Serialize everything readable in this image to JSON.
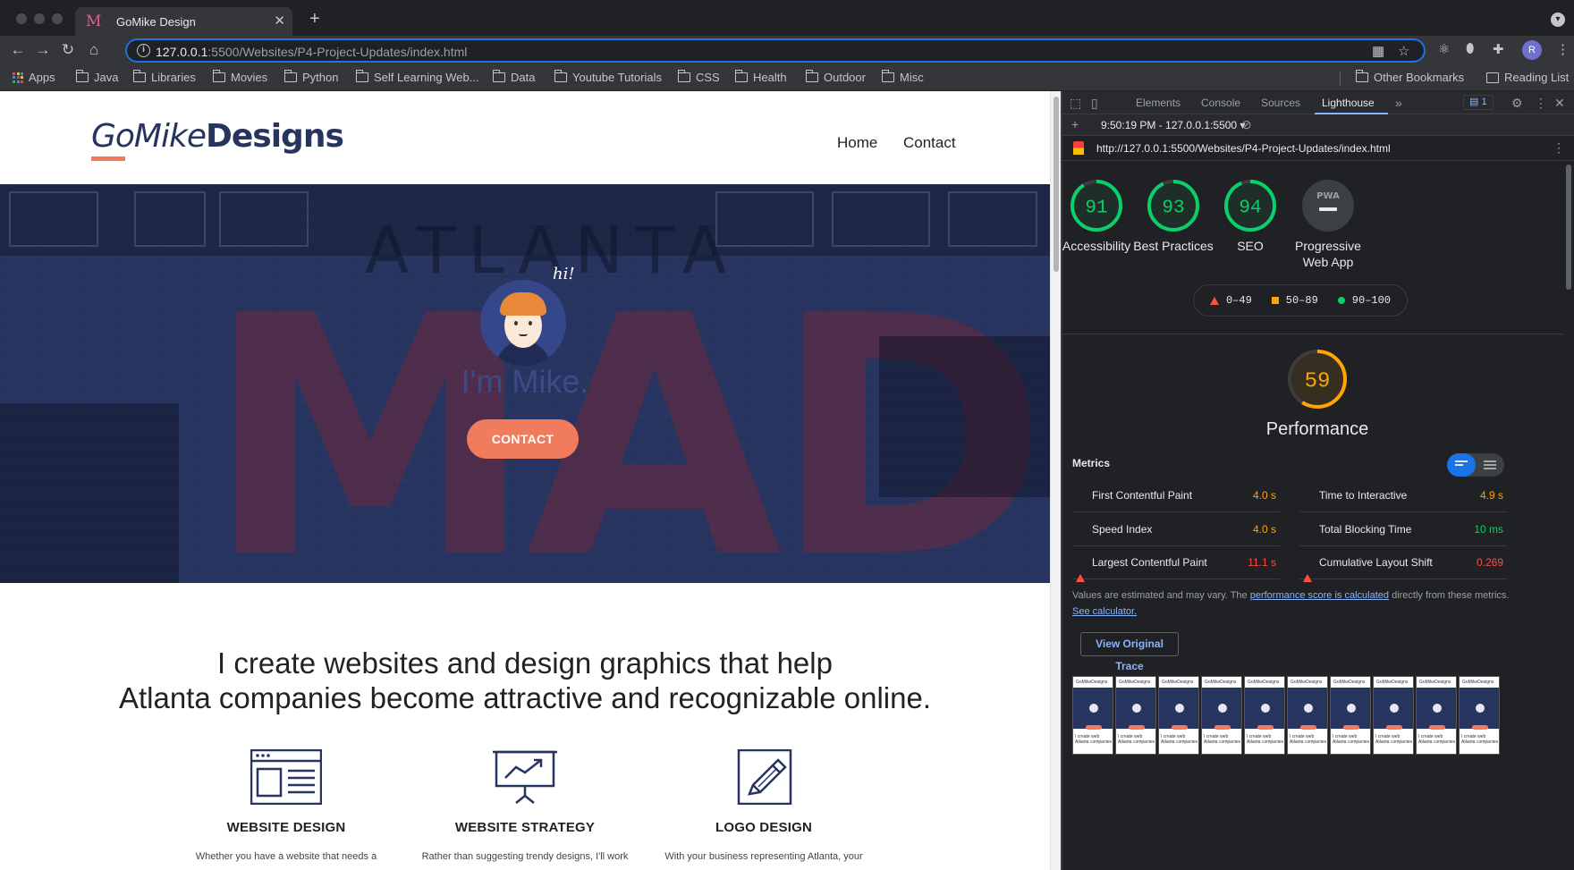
{
  "browser": {
    "tab_title": "GoMike Design",
    "tab_favicon": "M",
    "url_host": "127.0.0.1",
    "url_rest": ":5500/Websites/P4-Project-Updates/index.html",
    "profile_initial": "R",
    "bookmarks": [
      "Apps",
      "Java",
      "Libraries",
      "Movies",
      "Python",
      "Self Learning Web...",
      "Data",
      "Youtube Tutorials",
      "CSS",
      "Health",
      "Outdoor",
      "Misc"
    ],
    "other_bookmarks": "Other Bookmarks",
    "reading_list": "Reading List"
  },
  "site": {
    "logo_go": "GoMike",
    "logo_designs": "Designs",
    "nav": [
      "Home",
      "Contact"
    ],
    "hero_greeting": "hi!",
    "hero_title": "I'm Mike.",
    "hero_bg_word_1": "ATLANTA",
    "hero_bg_word_2": "MADE",
    "cta_label": "CONTACT",
    "tagline_line1": "I create websites and design graphics that help",
    "tagline_line2": "Atlanta companies become attractive and recognizable online.",
    "services": [
      {
        "name": "WEBSITE DESIGN",
        "icon": "website-layout-icon",
        "desc": "Whether you have a website that needs a"
      },
      {
        "name": "WEBSITE STRATEGY",
        "icon": "presentation-chart-icon",
        "desc": "Rather than suggesting trendy designs, I'll work"
      },
      {
        "name": "LOGO DESIGN",
        "icon": "pencil-icon",
        "desc": "With your business representing Atlanta, your"
      }
    ]
  },
  "devtools": {
    "tabs": [
      "Elements",
      "Console",
      "Sources",
      "Lighthouse"
    ],
    "active_tab": "Lighthouse",
    "issues_count": "1",
    "report_selector": "9:50:19 PM - 127.0.0.1:5500",
    "report_url": "http://127.0.0.1:5500/Websites/P4-Project-Updates/index.html",
    "scores": [
      {
        "label": "Performance",
        "value": 59,
        "color": "#ffa400"
      },
      {
        "label": "Accessibility",
        "value": 91,
        "color": "#0cce6b"
      },
      {
        "label": "Best Practices",
        "value": 93,
        "color": "#0cce6b"
      },
      {
        "label": "SEO",
        "value": 94,
        "color": "#0cce6b"
      }
    ],
    "pwa_label": "Progressive Web App",
    "pwa_badge": "PWA",
    "legend": {
      "fail": "0–49",
      "average": "50–89",
      "pass": "90–100"
    },
    "perf_title": "Performance",
    "perf_score": 59,
    "metrics_heading": "Metrics",
    "metrics": [
      {
        "name": "First Contentful Paint",
        "value": "4.0 s",
        "status": "average"
      },
      {
        "name": "Time to Interactive",
        "value": "4.9 s",
        "status": "average"
      },
      {
        "name": "Speed Index",
        "value": "4.0 s",
        "status": "average"
      },
      {
        "name": "Total Blocking Time",
        "value": "10 ms",
        "status": "pass"
      },
      {
        "name": "Largest Contentful Paint",
        "value": "11.1 s",
        "status": "fail"
      },
      {
        "name": "Cumulative Layout Shift",
        "value": "0.269",
        "status": "fail"
      }
    ],
    "note_pre": "Values are estimated and may vary. The ",
    "note_link": "performance score is calculated",
    "note_mid": " directly from these metrics. ",
    "note_link2": "See calculator.",
    "trace_button": "View Original Trace",
    "thumb_logo": "GoMikeDesigns",
    "thumb_text_1": "I create web",
    "thumb_text_2": "Atlanta companies",
    "status_colors": {
      "pass": "#0cce6b",
      "average": "#ffa400",
      "fail": "#ff4e42"
    }
  }
}
